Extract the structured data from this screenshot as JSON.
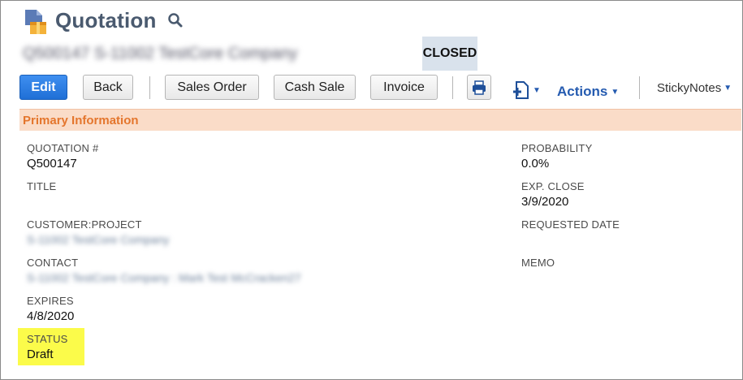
{
  "header": {
    "title": "Quotation",
    "record_name": "Q500147 S-11002 TestCore Company",
    "status": "CLOSED"
  },
  "toolbar": {
    "edit": "Edit",
    "back": "Back",
    "sales_order": "Sales Order",
    "cash_sale": "Cash Sale",
    "invoice": "Invoice",
    "actions": "Actions",
    "sticky_notes": "StickyNotes"
  },
  "section": {
    "title": "Primary Information"
  },
  "fields": {
    "quotation_label": "QUOTATION #",
    "quotation_value": "Q500147",
    "title_label": "TITLE",
    "customer_label": "CUSTOMER:PROJECT",
    "customer_value": "S-11002 TestCore Company",
    "contact_label": "CONTACT",
    "contact_value": "S-11002 TestCore Company : Mark Test McCracken27",
    "expires_label": "EXPIRES",
    "expires_value": "4/8/2020",
    "status_label": "STATUS",
    "status_value": "Draft",
    "probability_label": "PROBABILITY",
    "probability_value": "0.0%",
    "exp_close_label": "EXP. CLOSE",
    "exp_close_value": "3/9/2020",
    "requested_date_label": "REQUESTED DATE",
    "memo_label": "MEMO"
  },
  "colors": {
    "primary_button": "#1f6fd6",
    "section_header_bg": "#fadcc8",
    "section_header_text": "#e4762d",
    "status_highlight": "#fbfb4a",
    "title_color": "#4a5a6f"
  },
  "icons": {
    "record": "quotation-doc-icon",
    "search": "search-icon",
    "print": "print-icon",
    "new_document": "new-document-icon"
  }
}
